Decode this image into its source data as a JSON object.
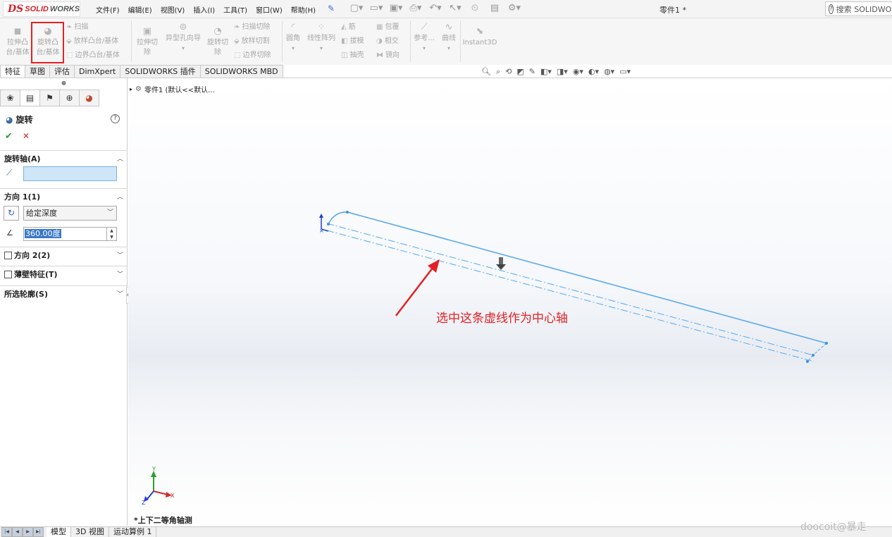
{
  "logo": {
    "ds": "DS",
    "brand_solid": "SOLID",
    "brand_works": "WORKS"
  },
  "menus": [
    "文件(F)",
    "编辑(E)",
    "视图(V)",
    "插入(I)",
    "工具(T)",
    "窗口(W)",
    "帮助(H)"
  ],
  "document_title": "零件1 *",
  "search": {
    "label": "搜索 SOLIDWORKS 帮助"
  },
  "toolbar": {
    "extrude_boss": "拉伸凸\n台/基体",
    "revolve_boss": "旋转凸\n台/基体",
    "sweep": "扫描",
    "loft_boss": "放样凸台/基体",
    "boundary_boss": "边界凸台/基体",
    "extrude_cut": "拉伸切\n除",
    "hole_wizard": "异型孔向导",
    "revolve_cut": "旋转切\n除",
    "swept_cut": "扫描切除",
    "lofted_cut": "放样切割",
    "boundary_cut": "边界切除",
    "fillet": "圆角",
    "linear_pattern": "线性阵列",
    "rib": "筋",
    "draft": "拔模",
    "shell": "抽壳",
    "wrap": "包覆",
    "intersect": "相交",
    "mirror": "镜向",
    "reference": "参考...",
    "curves": "曲线",
    "instant3d": "Instant3D"
  },
  "tabs": [
    "特征",
    "草图",
    "评估",
    "DimXpert",
    "SOLIDWORKS 插件",
    "SOLIDWORKS MBD"
  ],
  "property_manager": {
    "title": "旋转",
    "axis_group": "旋转轴(A)",
    "axis_value": "",
    "direction1_group": "方向 1(1)",
    "end_condition": "给定深度",
    "angle": "360.00度",
    "direction2_group": "方向 2(2)",
    "thin_feature_group": "薄壁特征(T)",
    "selected_contours_group": "所选轮廓(S)"
  },
  "viewport": {
    "tree_item": "零件1 (默认<<默认...",
    "annotation": "选中这条虚线作为中心轴",
    "view_name": "*上下二等角轴测",
    "triad_labels": [
      "Y",
      "X",
      "Z"
    ]
  },
  "bottom_tabs": [
    "模型",
    "3D 视图",
    "运动算例 1"
  ],
  "watermark": "doocoit@暴走",
  "colors": {
    "accent_red": "#e32124",
    "sketch_blue": "#5aa9f0",
    "ok_green": "#2e9a35"
  },
  "icons": [
    "search-icon",
    "pin-icon",
    "check-icon",
    "close-icon",
    "help-icon",
    "revolve-icon",
    "axis-line-icon",
    "reverse-direction-icon",
    "angle-icon"
  ]
}
